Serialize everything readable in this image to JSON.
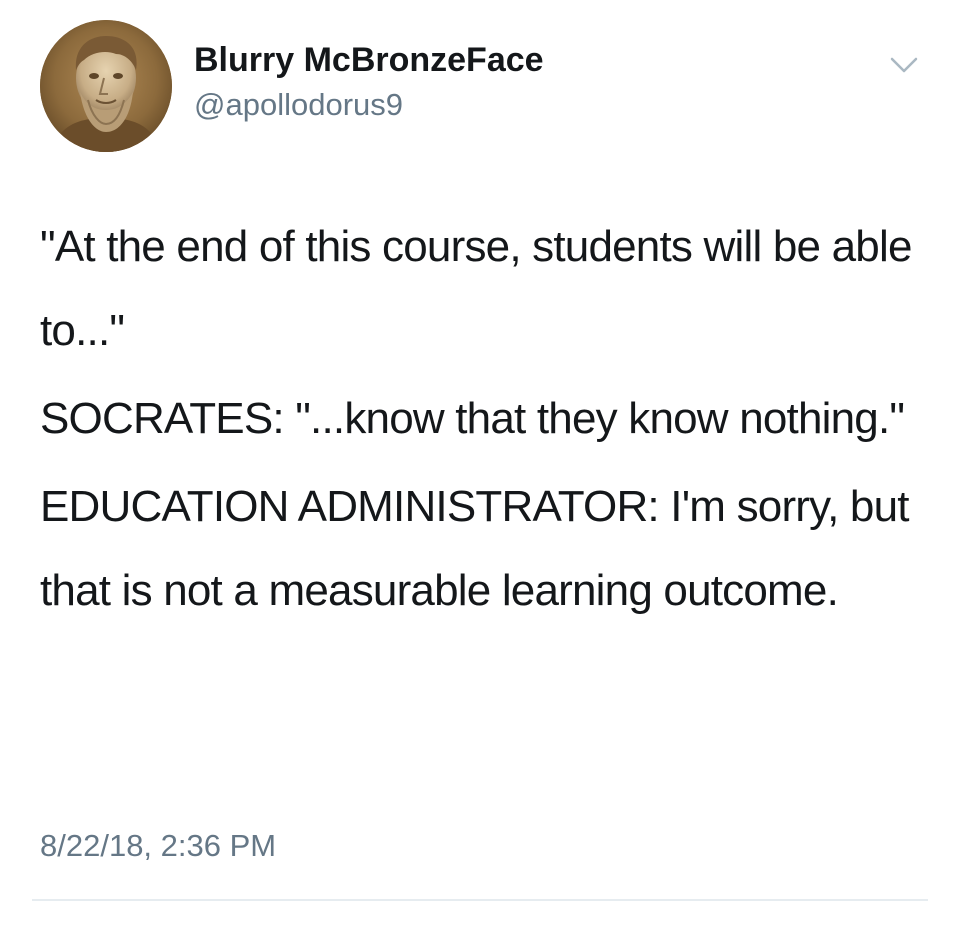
{
  "author": {
    "display_name": "Blurry McBronzeFace",
    "handle": "@apollodorus9",
    "avatar_icon": "bronze-bust-avatar"
  },
  "menu": {
    "icon": "chevron-down-icon"
  },
  "tweet": {
    "paragraphs": [
      "\"At the end of this course, students will be able to...\"",
      "SOCRATES: \"...know that they know nothing.\"",
      "EDUCATION ADMINISTRATOR: I'm sorry, but that is not a measurable learning outcome."
    ],
    "timestamp": "8/22/18, 2:36 PM"
  },
  "colors": {
    "text": "#14171a",
    "secondary_text": "#657786",
    "divider": "#e6ecf0",
    "background": "#ffffff"
  }
}
